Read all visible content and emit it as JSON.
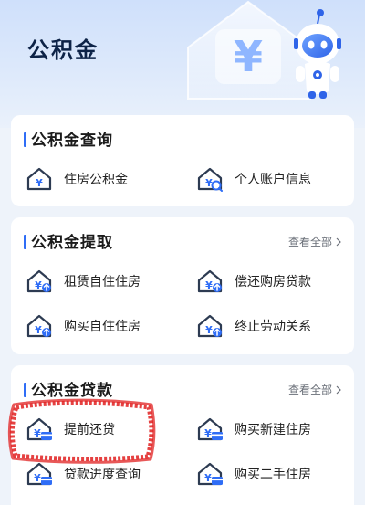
{
  "header": {
    "title": "公积金"
  },
  "hero_art": {
    "symbol": "¥"
  },
  "query": {
    "title": "公积金查询",
    "items": [
      {
        "label": "住房公积金",
        "icon": "house-yen-icon"
      },
      {
        "label": "个人账户信息",
        "icon": "house-yen-search-icon"
      }
    ]
  },
  "withdraw": {
    "title": "公积金提取",
    "view_all": "查看全部",
    "items": [
      {
        "label": "租赁自住住房",
        "icon": "house-yen-upload-icon"
      },
      {
        "label": "偿还购房贷款",
        "icon": "house-yen-upload-icon"
      },
      {
        "label": "购买自住住房",
        "icon": "house-yen-upload-icon"
      },
      {
        "label": "终止劳动关系",
        "icon": "house-yen-upload-icon"
      }
    ]
  },
  "loan": {
    "title": "公积金贷款",
    "view_all": "查看全部",
    "items": [
      {
        "label": "提前还贷",
        "icon": "house-yen-card-icon"
      },
      {
        "label": "购买新建住房",
        "icon": "house-yen-card-icon"
      },
      {
        "label": "贷款进度查询",
        "icon": "house-yen-card-icon"
      },
      {
        "label": "购买二手住房",
        "icon": "house-yen-card-icon"
      }
    ]
  },
  "colors": {
    "accent": "#2f6df6",
    "icon_dark": "#2d3b52",
    "highlight": "#e02020"
  }
}
